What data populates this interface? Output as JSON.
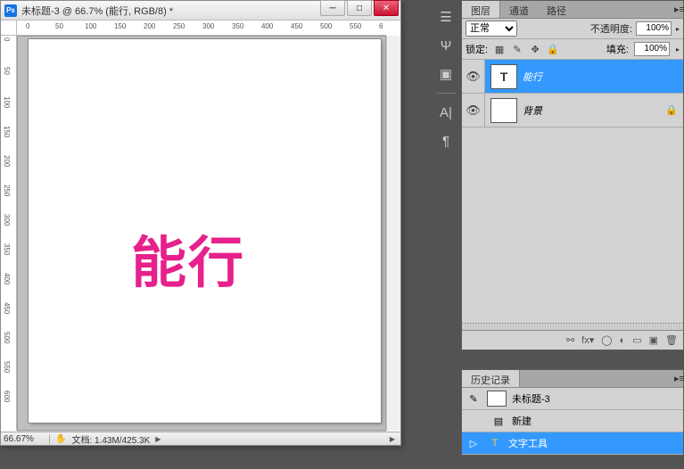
{
  "doc": {
    "title": "未标题-3 @ 66.7% (能行, RGB/8) *",
    "zoom": "66.67%",
    "docinfo": "文档:  1.43M/425.3K",
    "maintext": "能行",
    "ruler_h": [
      "0",
      "50",
      "100",
      "150",
      "200",
      "250",
      "300",
      "350",
      "400",
      "450",
      "500",
      "550",
      "6"
    ],
    "ruler_v": [
      "0",
      "50",
      "100",
      "150",
      "200",
      "250",
      "300",
      "350",
      "400",
      "450",
      "500",
      "550",
      "600"
    ]
  },
  "layers_panel": {
    "tabs": [
      "图层",
      "通道",
      "路径"
    ],
    "blendmode": "正常",
    "opacity_lbl": "不透明度:",
    "opacity_val": "100%",
    "lock_lbl": "锁定:",
    "fill_lbl": "填充:",
    "fill_val": "100%",
    "layers": [
      {
        "name": "能行",
        "type": "T",
        "selected": true,
        "locked": false
      },
      {
        "name": "背景",
        "type": "bg",
        "selected": false,
        "locked": true
      }
    ]
  },
  "history_panel": {
    "tab": "历史记录",
    "snapshot": "未标题-3",
    "items": [
      {
        "name": "新建",
        "selected": false
      },
      {
        "name": "文字工具",
        "selected": true
      }
    ]
  }
}
